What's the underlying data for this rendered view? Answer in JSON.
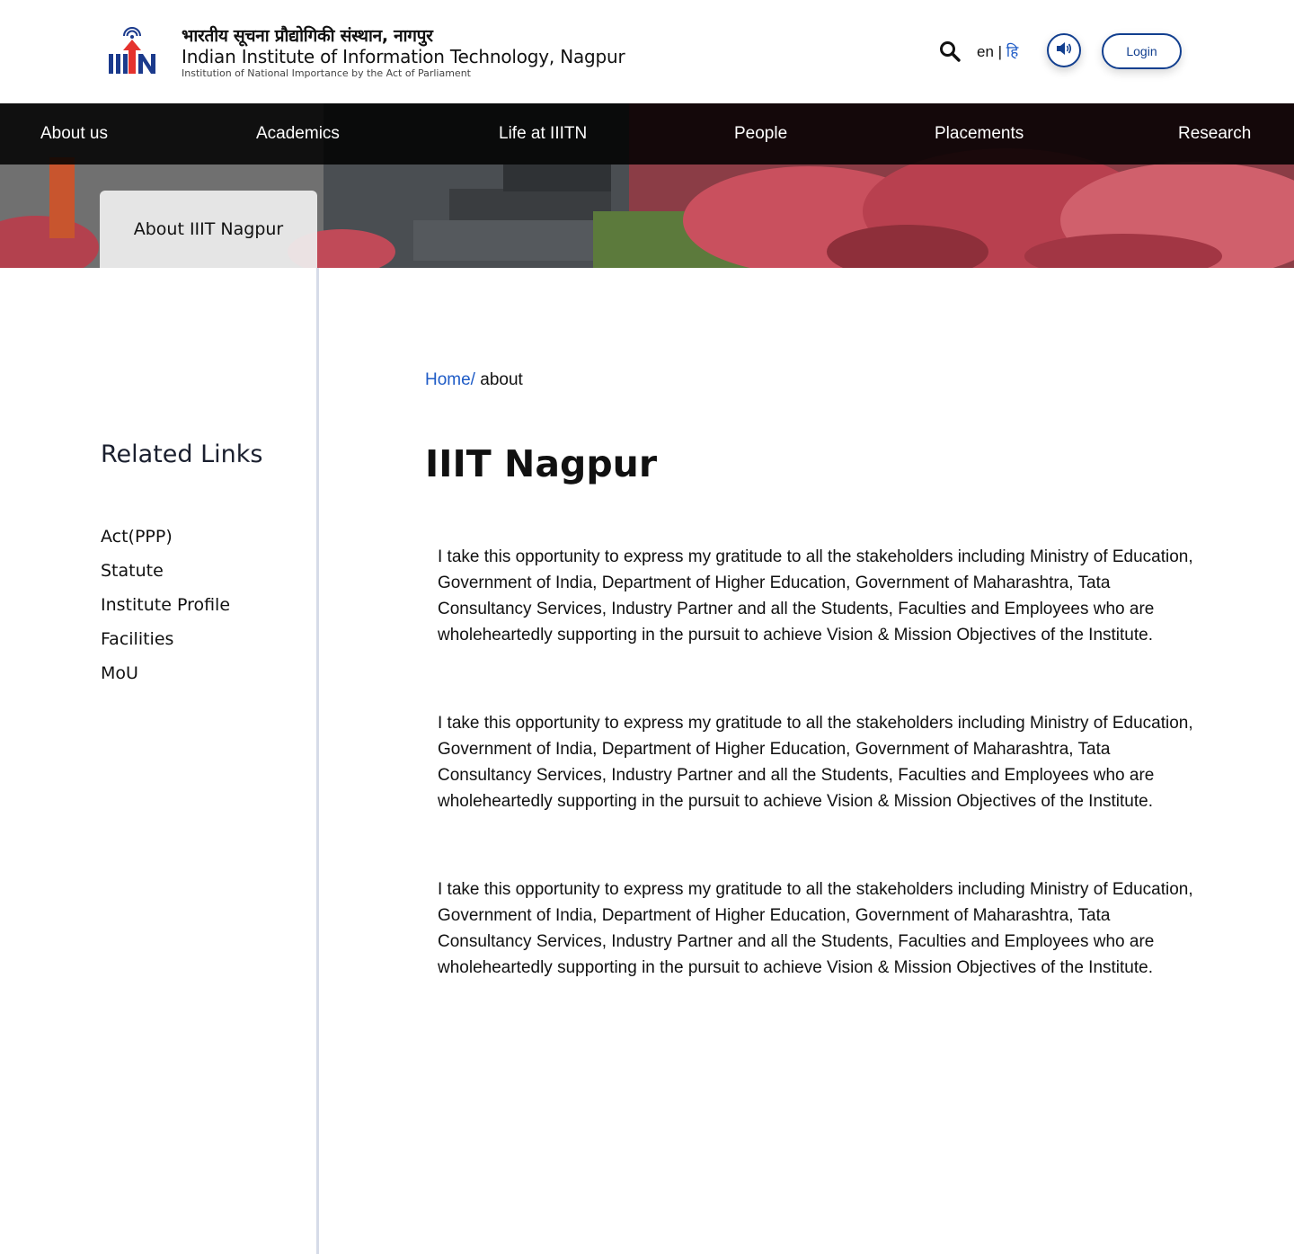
{
  "header": {
    "title_hi": "भारतीय सूचना प्रौद्योगिकी संस्थान, नागपुर",
    "title_en": "Indian Institute of Information Technology, Nagpur",
    "subtitle": "Institution of National Importance by the Act of Parliament",
    "lang_en": "en",
    "lang_sep": " | ",
    "lang_hi": "हि",
    "login_label": "Login",
    "icons": [
      "logo-icon",
      "search-icon",
      "speaker-icon"
    ]
  },
  "nav": {
    "items": [
      {
        "label": "About us"
      },
      {
        "label": "Academics"
      },
      {
        "label": "Life at IIITN"
      },
      {
        "label": "People"
      },
      {
        "label": "Placements"
      },
      {
        "label": "Research"
      }
    ]
  },
  "banner": {
    "tab_label": "About IIIT Nagpur"
  },
  "sidebar": {
    "title": "Related Links",
    "links": [
      {
        "label": "Act(PPP)"
      },
      {
        "label": "Statute"
      },
      {
        "label": "Institute Profile"
      },
      {
        "label": "Facilities"
      },
      {
        "label": "MoU"
      }
    ]
  },
  "main": {
    "breadcrumb_home": "Home/",
    "breadcrumb_current": " about",
    "title": "IIIT Nagpur",
    "paragraphs": [
      "I take this opportunity to express my gratitude to all the stakeholders including Ministry of Education, Government of India, Department of Higher Education, Government of Maharashtra, Tata Consultancy Services, Industry Partner and all the Students, Faculties and Employees who are wholeheartedly supporting in the pursuit to achieve Vision & Mission Objectives of the Institute.",
      "I take this opportunity to express my gratitude to all the stakeholders including Ministry of Education, Government of India, Department of Higher Education, Government of Maharashtra, Tata Consultancy Services, Industry Partner and all the Students, Faculties and Employees who are wholeheartedly supporting in the pursuit to achieve Vision & Mission Objectives of the Institute.",
      "I take this opportunity to express my gratitude to all the stakeholders including Ministry of Education, Government of India, Department of Higher Education, Government of Maharashtra, Tata Consultancy Services, Industry Partner and all the Students, Faculties and Employees who are wholeheartedly supporting in the pursuit to achieve Vision & Mission Objectives of the Institute."
    ]
  },
  "colors": {
    "accent_blue": "#1e5bc6",
    "navy": "#123f8f",
    "logo_red": "#e5322d",
    "divider": "#d6dbe8"
  }
}
